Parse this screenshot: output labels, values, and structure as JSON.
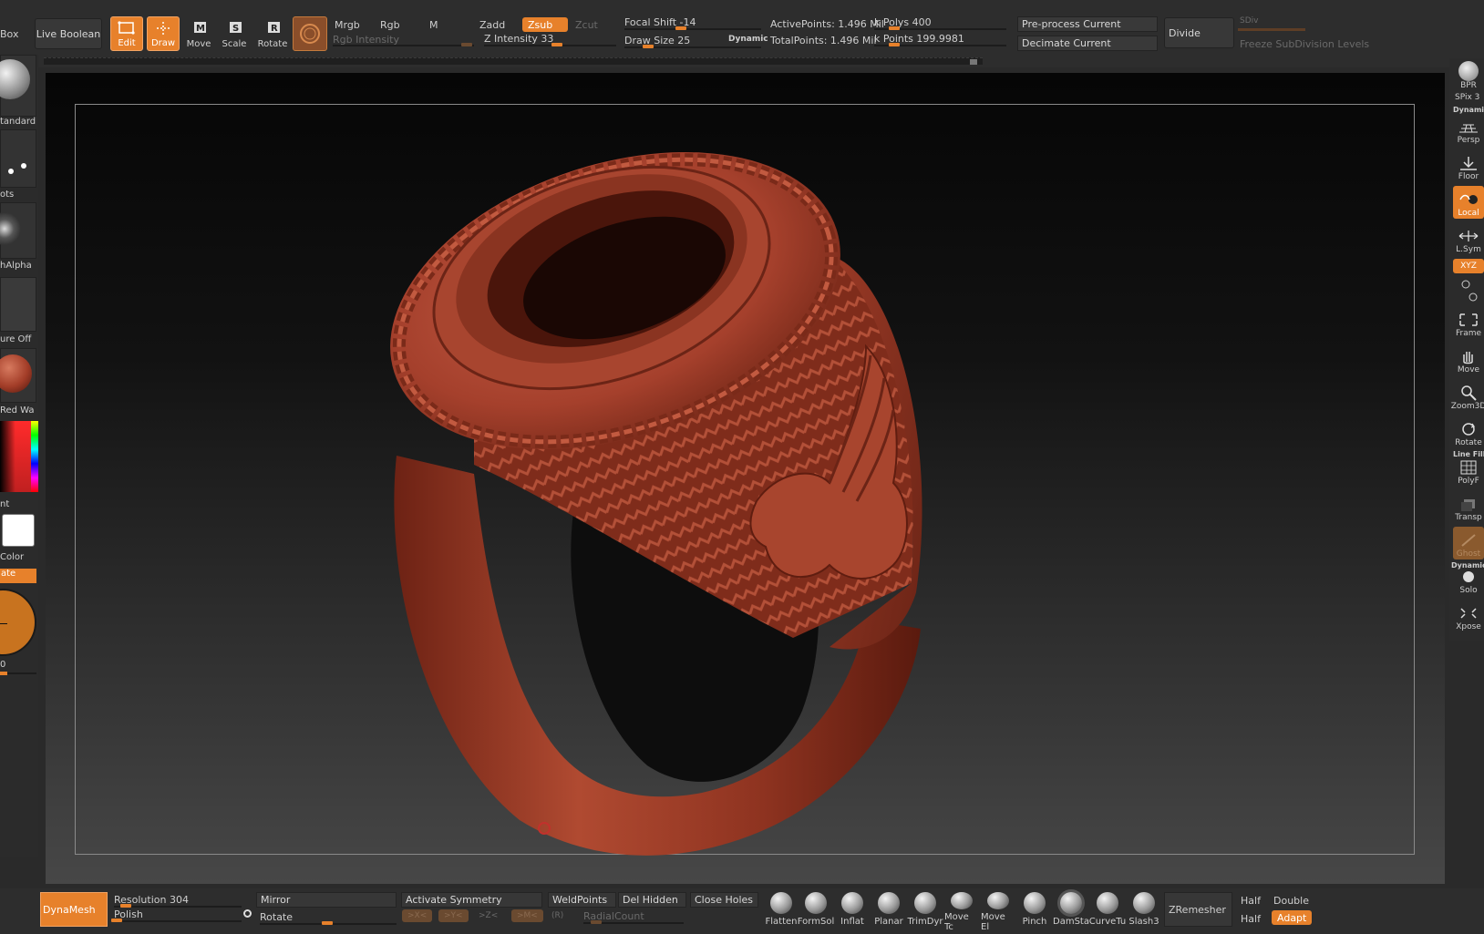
{
  "toolbar": {
    "box_label": "Box",
    "live_boolean": "Live Boolean",
    "tools": [
      {
        "label": "Edit"
      },
      {
        "label": "Draw"
      },
      {
        "label": "Move"
      },
      {
        "label": "Scale"
      },
      {
        "label": "Rotate"
      }
    ],
    "mrgb": "Mrgb",
    "rgb": "Rgb",
    "m": "M",
    "rgb_intensity": "Rgb Intensity",
    "zadd": "Zadd",
    "zsub": "Zsub",
    "zcut": "Zcut",
    "z_intensity": "Z Intensity 33",
    "focal_shift": "Focal Shift -14",
    "draw_size": "Draw Size 25",
    "dynamic": "Dynamic",
    "active_points": "ActivePoints: 1.496 Mil",
    "total_points": "TotalPoints: 1.496 Mil",
    "k_polys": "k Polys 400",
    "k_points": "k Points 199.9981",
    "preprocess": "Pre-process Current",
    "decimate": "Decimate Current",
    "divide": "Divide",
    "sdiv": "SDiv",
    "freeze": "Freeze SubDivision Levels"
  },
  "left_shelf": {
    "brush": "tandard",
    "stroke": "ots",
    "alpha": "hAlpha",
    "texture": "ure Off",
    "material": "Red Wa",
    "gradient_label": "nt",
    "switch_color": "Color",
    "alternate": "ate",
    "value": "0"
  },
  "right_shelf": {
    "items": [
      "BPR",
      "SPix 3",
      "Persp",
      "Floor",
      "Local",
      "L.Sym",
      "XYZ",
      "Frame",
      "Move",
      "Zoom3D",
      "Rotate",
      "PolyF",
      "Transp",
      "Ghost",
      "Solo",
      "Xpose"
    ],
    "dynamic_label": "Dynamic",
    "line_fill": "Line Fill",
    "dynamic2": "Dynamic"
  },
  "bottom": {
    "dynamesh": "DynaMesh",
    "resolution": "Resolution 304",
    "polish": "Polish",
    "mirror": "Mirror",
    "rotate": "Rotate",
    "activate_symmetry": "Activate Symmetry",
    "x": ">X<",
    "y": ">Y<",
    "z": ">Z<",
    "m": ">M<",
    "r": "(R)",
    "radial_count": "RadialCount",
    "weld_points": "WeldPoints",
    "del_hidden": "Del Hidden",
    "close_holes": "Close Holes",
    "brushes": [
      "Flatten",
      "FormSol",
      "Inflat",
      "Planar",
      "TrimDyr",
      "Move Tc",
      "Move El",
      "Pinch",
      "DamSta",
      "CurveTu",
      "Slash3"
    ],
    "zremesher": "ZRemesher",
    "half1": "Half",
    "half2": "Half",
    "double": "Double",
    "adapt": "Adapt"
  },
  "colors": {
    "accent": "#e7812b",
    "ring": "#a5402c",
    "canvas_top": "#060606",
    "canvas_bottom": "#474747"
  }
}
